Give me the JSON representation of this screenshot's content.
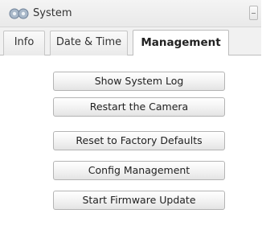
{
  "window": {
    "title": "System",
    "icon": "gears-icon"
  },
  "tabs": [
    {
      "label": "Info"
    },
    {
      "label": "Date & Time"
    },
    {
      "label": "Management",
      "selected": true
    }
  ],
  "actions": [
    {
      "label": "Show System Log"
    },
    {
      "label": "Restart the Camera"
    },
    {
      "label": "Reset to Factory Defaults"
    },
    {
      "label": "Config Management"
    },
    {
      "label": "Start Firmware Update"
    }
  ]
}
